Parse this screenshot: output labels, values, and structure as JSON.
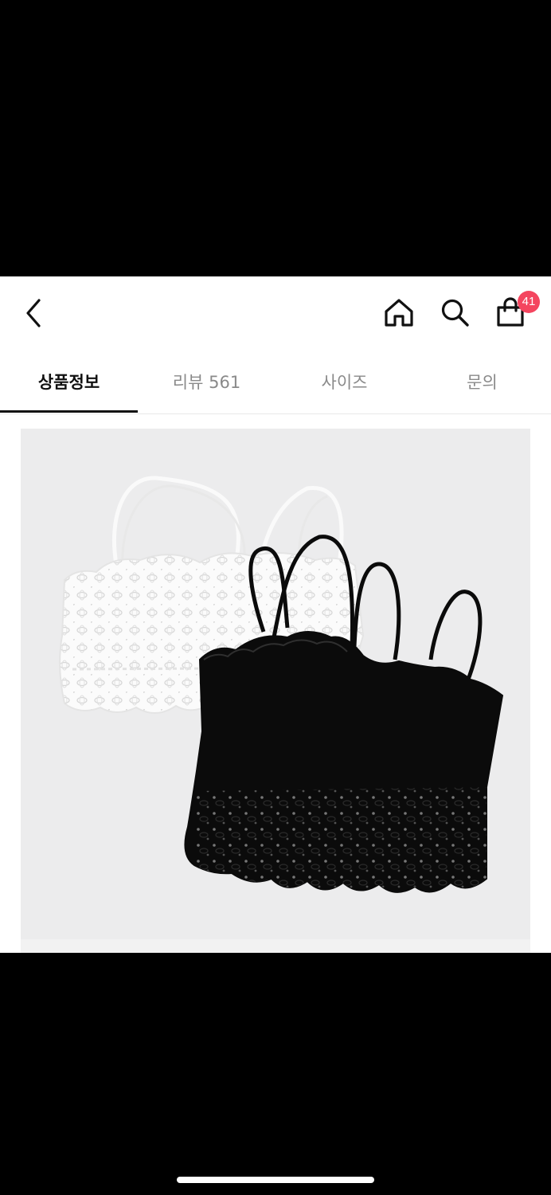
{
  "header": {
    "back_icon": "chevron-left-icon",
    "home_icon": "home-icon",
    "search_icon": "search-icon",
    "cart_icon": "shopping-bag-icon",
    "cart_count": "41",
    "badge_color": "#f4455f"
  },
  "tabs": [
    {
      "label": "상품정보",
      "active": true
    },
    {
      "label": "리뷰 561",
      "active": false
    },
    {
      "label": "사이즈",
      "active": false
    },
    {
      "label": "문의",
      "active": false
    }
  ],
  "product_image": {
    "subject": "white and black lace bralette tops"
  }
}
